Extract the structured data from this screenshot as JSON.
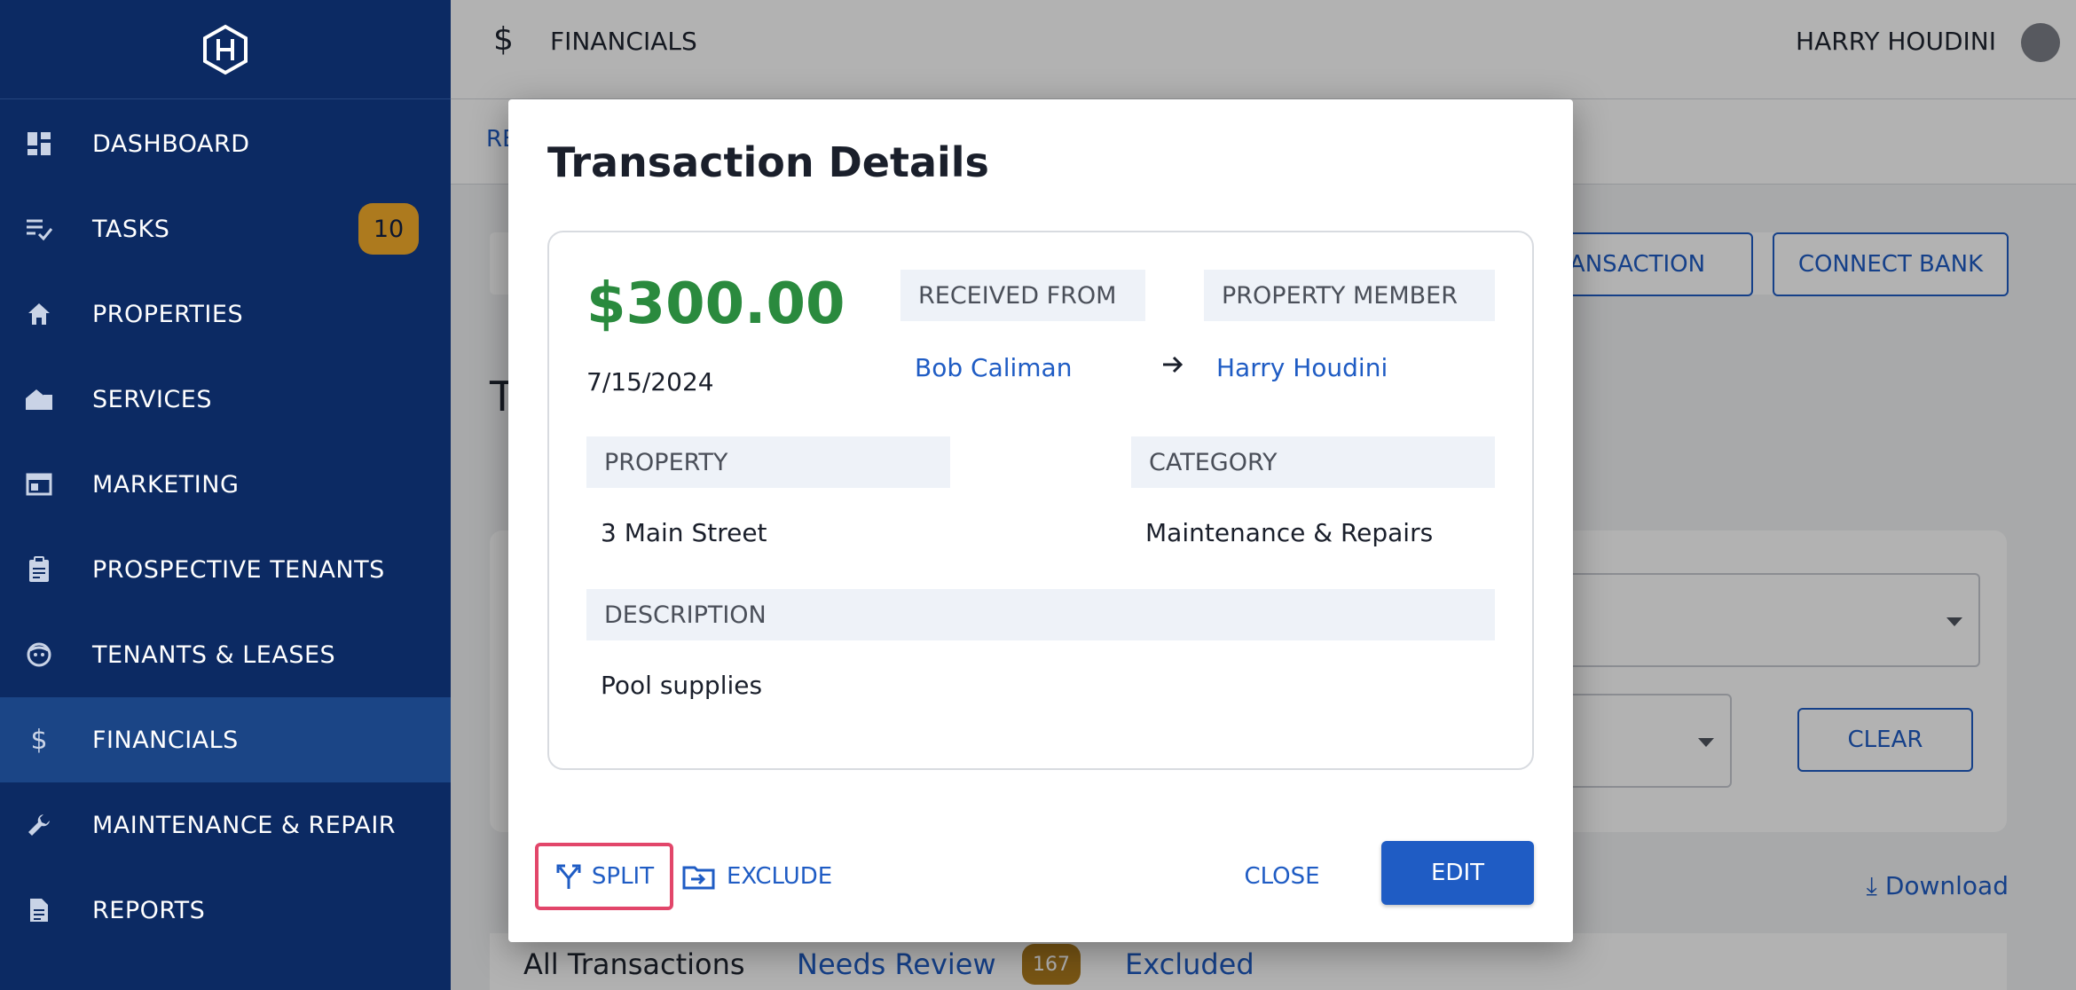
{
  "sidebar": {
    "items": [
      {
        "label": "DASHBOARD",
        "icon": "dashboard-icon"
      },
      {
        "label": "TASKS",
        "icon": "tasks-icon",
        "badge": "10"
      },
      {
        "label": "PROPERTIES",
        "icon": "home-icon"
      },
      {
        "label": "SERVICES",
        "icon": "services-icon"
      },
      {
        "label": "MARKETING",
        "icon": "marketing-icon"
      },
      {
        "label": "PROSPECTIVE TENANTS",
        "icon": "clipboard-icon"
      },
      {
        "label": "TENANTS & LEASES",
        "icon": "face-icon"
      },
      {
        "label": "FINANCIALS",
        "icon": "dollar-icon"
      },
      {
        "label": "MAINTENANCE & REPAIR",
        "icon": "wrench-icon"
      },
      {
        "label": "REPORTS",
        "icon": "report-icon"
      }
    ],
    "active_index": 7
  },
  "header": {
    "title": "FINANCIALS",
    "title_icon": "$",
    "user": "HARRY HOUDINI"
  },
  "subnav": {
    "tab_partial": "RE"
  },
  "actions": {
    "add_transaction_partial": "RANSACTION",
    "connect_bank": "CONNECT BANK"
  },
  "page": {
    "heading_partial": "T",
    "clear": "CLEAR",
    "download": "Download"
  },
  "tabs": {
    "all": "All Transactions",
    "review": "Needs Review",
    "review_count": "167",
    "excluded": "Excluded"
  },
  "modal": {
    "title": "Transaction Details",
    "amount": "$300.00",
    "date": "7/15/2024",
    "received_from_label": "RECEIVED FROM",
    "received_from_value": "Bob Caliman",
    "property_member_label": "PROPERTY MEMBER",
    "property_member_value": "Harry Houdini",
    "property_label": "PROPERTY",
    "property_value": "3 Main Street",
    "category_label": "CATEGORY",
    "category_value": "Maintenance & Repairs",
    "description_label": "DESCRIPTION",
    "description_value": "Pool supplies",
    "split": "SPLIT",
    "exclude": "EXCLUDE",
    "close": "CLOSE",
    "edit": "EDIT"
  },
  "colors": {
    "sidebar_bg": "#0c2a63",
    "sidebar_active": "#1b4586",
    "accent_blue": "#1f5cc4",
    "amount_green": "#2a8a3e",
    "badge_gold": "#ad7a1e",
    "highlight_red": "#e2466a"
  }
}
